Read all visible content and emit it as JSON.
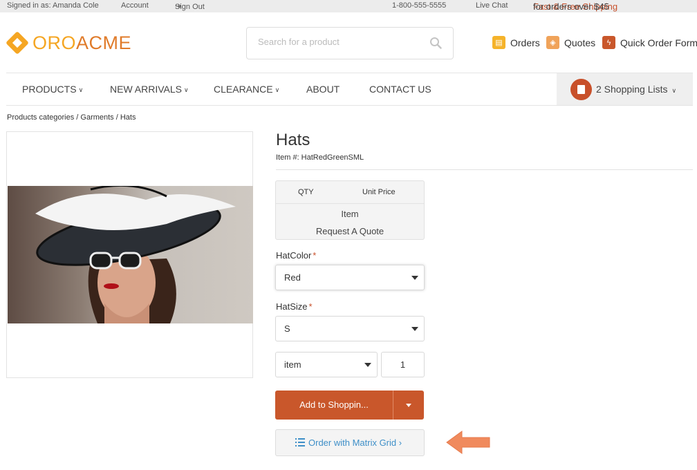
{
  "topbar": {
    "signed_in": "Signed in as: Amanda Cole",
    "account": "Account",
    "sign_out": "Sign Out",
    "phone": "1-800-555-5555",
    "live_chat": "Live Chat",
    "shipping_highlight": "Fast & Free Shipping",
    "shipping_rest": " for orders over $45"
  },
  "logo": {
    "part1": "ORO",
    "part2": "ACME"
  },
  "search": {
    "placeholder": "Search for a product"
  },
  "header_links": {
    "orders": "Orders",
    "quotes": "Quotes",
    "quick_order_form": "Quick Order Form"
  },
  "nav": {
    "products": "PRODUCTS",
    "new_arrivals": "NEW ARRIVALS",
    "clearance": "CLEARANCE",
    "about": "ABOUT",
    "contact": "CONTACT US"
  },
  "shopping_lists": {
    "label": "2 Shopping Lists"
  },
  "breadcrumb": {
    "c1": "Products categories",
    "c2": "Garments",
    "c3": "Hats",
    "sep": " / "
  },
  "product": {
    "title": "Hats",
    "item_number": "Item #: HatRedGreenSML",
    "price_table": {
      "qty_header": "QTY",
      "unit_price_header": "Unit Price",
      "item": "Item",
      "request_quote": "Request A Quote"
    },
    "hat_color": {
      "label": "HatColor",
      "required": "*",
      "value": "Red"
    },
    "hat_size": {
      "label": "HatSize",
      "required": "*",
      "value": "S"
    },
    "unit": "item",
    "quantity": "1",
    "add_button": "Add to Shoppin...",
    "matrix_button": "Order with Matrix Grid ›"
  },
  "colors": {
    "accent": "#c9572b",
    "brand_orange": "#f5a623",
    "link_blue": "#3e8fc8"
  }
}
